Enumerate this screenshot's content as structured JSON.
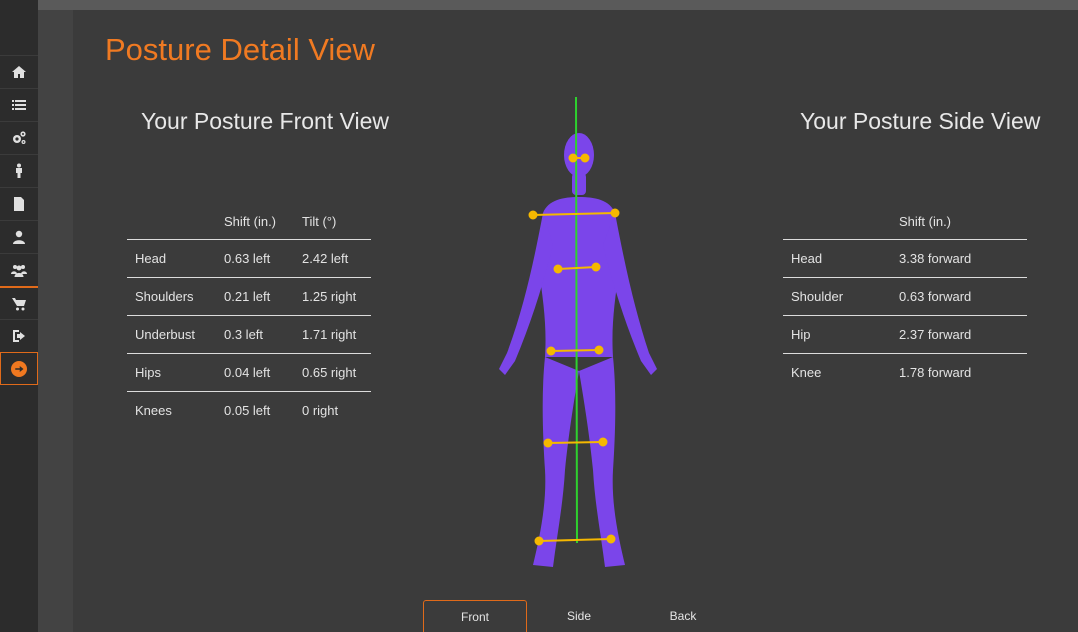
{
  "page_title": "Posture Detail View",
  "front": {
    "title": "Your Posture Front View",
    "headers": [
      "",
      "Shift (in.)",
      "Tilt (°)"
    ],
    "rows": [
      [
        "Head",
        "0.63 left",
        "2.42 left"
      ],
      [
        "Shoulders",
        "0.21 left",
        "1.25 right"
      ],
      [
        "Underbust",
        "0.3 left",
        "1.71 right"
      ],
      [
        "Hips",
        "0.04 left",
        "0.65 right"
      ],
      [
        "Knees",
        "0.05 left",
        "0 right"
      ]
    ]
  },
  "side": {
    "title": "Your Posture Side View",
    "headers": [
      "",
      "Shift (in.)"
    ],
    "rows": [
      [
        "Head",
        "3.38 forward"
      ],
      [
        "Shoulder",
        "0.63 forward"
      ],
      [
        "Hip",
        "2.37 forward"
      ],
      [
        "Knee",
        "1.78 forward"
      ]
    ]
  },
  "tabs": [
    "Front",
    "Side",
    "Back"
  ],
  "active_tab": "Front",
  "sidebar_icons": [
    "home-icon",
    "list-icon",
    "gears-icon",
    "person-icon",
    "document-icon",
    "user-icon",
    "users-icon",
    "cart-icon",
    "sign-out-icon",
    "arrow-right-circle-icon"
  ],
  "colors": {
    "accent": "#f07a22",
    "figure": "#7b45ea",
    "plumb_line": "#2ed12e",
    "markers": "#f5b800"
  }
}
